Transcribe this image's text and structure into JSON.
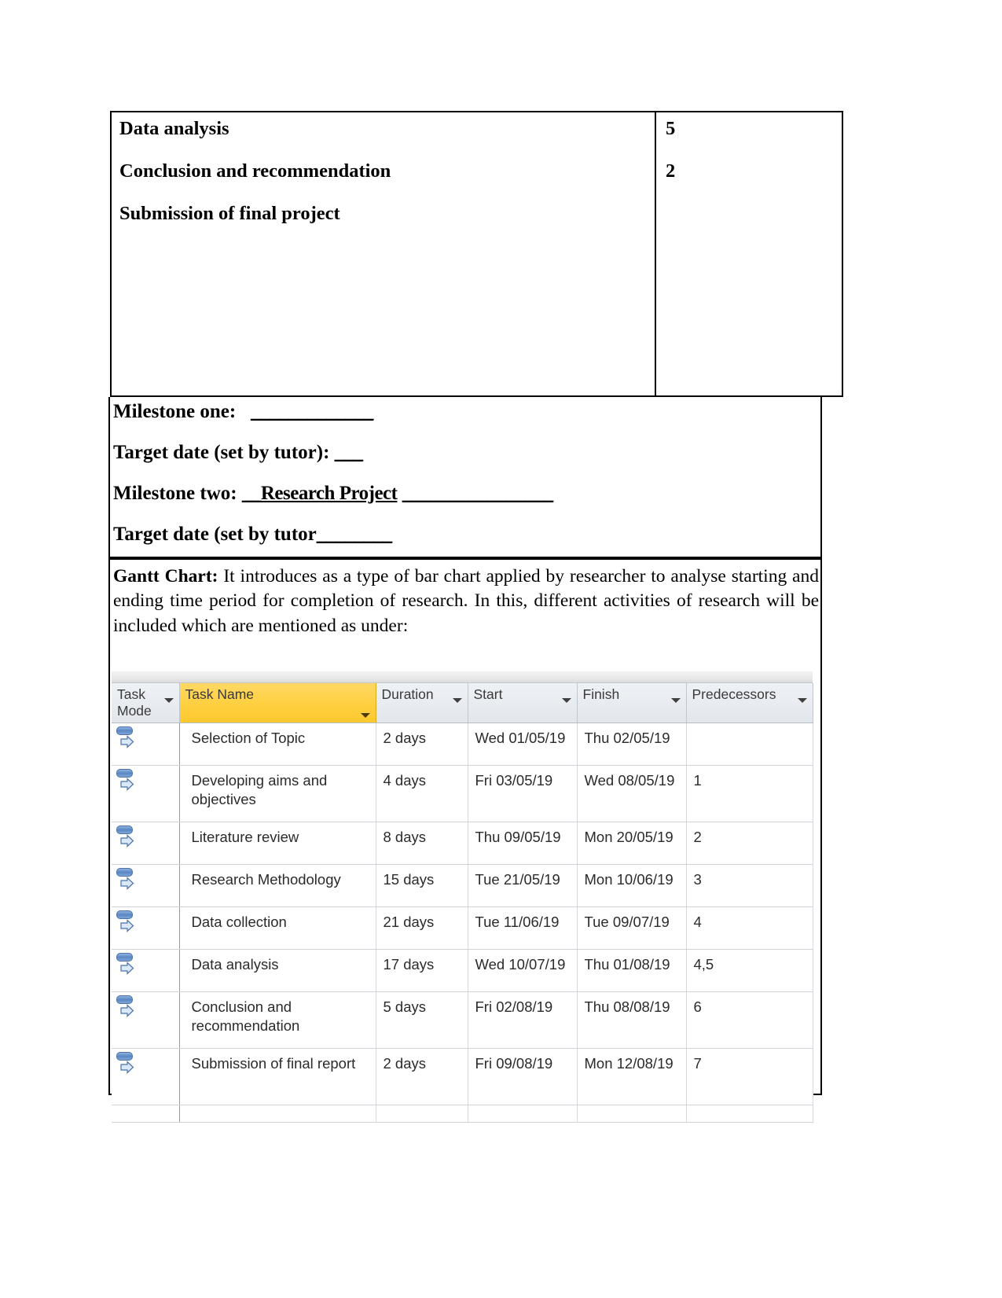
{
  "top_table": {
    "left_rows": [
      "Data analysis",
      "Conclusion and recommendation",
      "Submission of final project"
    ],
    "right_rows": [
      "5",
      "2"
    ]
  },
  "milestones": {
    "line1_label": "Milestone one:",
    "line1_blank": "_____________",
    "line2_label": "Target date (set by tutor):",
    "line2_blank": "___",
    "line3_label": "Milestone two:",
    "line3_value": "__Research Project",
    "line3_blank": "________________",
    "line4_label": "Target date (set by tutor",
    "line4_blank": "________"
  },
  "gantt_paragraph": {
    "heading": "Gantt Chart:",
    "body": " It introduces as a type of bar chart applied by researcher to analyse starting and ending time period for completion of research. In this, different activities of research will be included which are mentioned as under:"
  },
  "project_table": {
    "columns": [
      {
        "label": "Task Mode",
        "highlight": false,
        "filter_icon": "filter-arrow-icon"
      },
      {
        "label": "Task Name",
        "highlight": true,
        "filter_icon": "filter-arrow-icon"
      },
      {
        "label": "Duration",
        "highlight": false,
        "filter_icon": "filter-arrow-icon"
      },
      {
        "label": "Start",
        "highlight": false,
        "filter_icon": "filter-arrow-icon"
      },
      {
        "label": "Finish",
        "highlight": false,
        "filter_icon": "filter-arrow-icon"
      },
      {
        "label": "Predecessors",
        "highlight": false,
        "filter_icon": "filter-arrow-icon"
      }
    ],
    "header_highlight_color": "#FFCF3F",
    "rows": [
      {
        "mode_icon": "auto-scheduled-icon",
        "name": "Selection of Topic",
        "duration": "2 days",
        "start": "Wed 01/05/19",
        "finish": "Thu 02/05/19",
        "predecessors": ""
      },
      {
        "mode_icon": "auto-scheduled-icon",
        "name": "Developing aims and objectives",
        "duration": "4 days",
        "start": "Fri 03/05/19",
        "finish": "Wed 08/05/19",
        "predecessors": "1"
      },
      {
        "mode_icon": "auto-scheduled-icon",
        "name": "Literature review",
        "duration": "8 days",
        "start": "Thu 09/05/19",
        "finish": "Mon 20/05/19",
        "predecessors": "2"
      },
      {
        "mode_icon": "auto-scheduled-icon",
        "name": "Research Methodology",
        "duration": "15 days",
        "start": "Tue 21/05/19",
        "finish": "Mon 10/06/19",
        "predecessors": "3"
      },
      {
        "mode_icon": "auto-scheduled-icon",
        "name": "Data collection",
        "duration": "21 days",
        "start": "Tue 11/06/19",
        "finish": "Tue 09/07/19",
        "predecessors": "4"
      },
      {
        "mode_icon": "auto-scheduled-icon",
        "name": "Data analysis",
        "duration": "17 days",
        "start": "Wed 10/07/19",
        "finish": "Thu 01/08/19",
        "predecessors": "4,5"
      },
      {
        "mode_icon": "auto-scheduled-icon",
        "name": "Conclusion and recommendation",
        "duration": "5 days",
        "start": "Fri 02/08/19",
        "finish": "Thu 08/08/19",
        "predecessors": "6"
      },
      {
        "mode_icon": "auto-scheduled-icon",
        "name": "Submission of final report",
        "duration": "2 days",
        "start": "Fri 09/08/19",
        "finish": "Mon 12/08/19",
        "predecessors": "7"
      }
    ]
  },
  "chart_data": {
    "type": "table",
    "title": "Gantt Chart task schedule",
    "columns": [
      "Task Mode",
      "Task Name",
      "Duration",
      "Start",
      "Finish",
      "Predecessors"
    ],
    "rows": [
      [
        "Auto Scheduled",
        "Selection of Topic",
        "2 days",
        "Wed 01/05/19",
        "Thu 02/05/19",
        ""
      ],
      [
        "Auto Scheduled",
        "Developing aims and objectives",
        "4 days",
        "Fri 03/05/19",
        "Wed 08/05/19",
        "1"
      ],
      [
        "Auto Scheduled",
        "Literature review",
        "8 days",
        "Thu 09/05/19",
        "Mon 20/05/19",
        "2"
      ],
      [
        "Auto Scheduled",
        "Research Methodology",
        "15 days",
        "Tue 21/05/19",
        "Mon 10/06/19",
        "3"
      ],
      [
        "Auto Scheduled",
        "Data collection",
        "21 days",
        "Tue 11/06/19",
        "Tue 09/07/19",
        "4"
      ],
      [
        "Auto Scheduled",
        "Data analysis",
        "17 days",
        "Wed 10/07/19",
        "Thu 01/08/19",
        "4,5"
      ],
      [
        "Auto Scheduled",
        "Conclusion and recommendation",
        "5 days",
        "Fri 02/08/19",
        "Thu 08/08/19",
        "6"
      ],
      [
        "Auto Scheduled",
        "Submission of final report",
        "2 days",
        "Fri 09/08/19",
        "Mon 12/08/19",
        "7"
      ]
    ],
    "durations_days": [
      2,
      4,
      8,
      15,
      21,
      17,
      5,
      2
    ]
  }
}
